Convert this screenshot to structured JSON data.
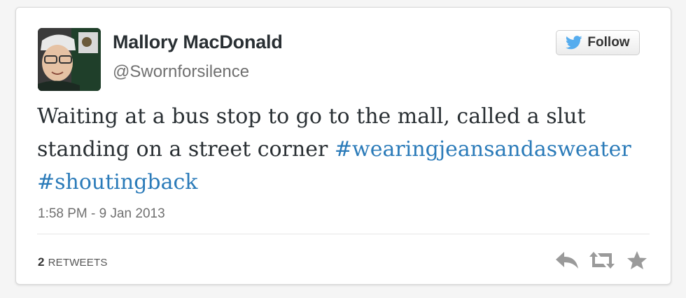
{
  "author": {
    "name": "Mallory MacDonald",
    "handle": "@Swornforsilence"
  },
  "follow_button": {
    "label": "Follow",
    "icon": "twitter-bird-icon",
    "accent": "#55acee"
  },
  "tweet": {
    "text_part1": "Waiting at a bus stop to go to the mall, called a slut standing on a street corner ",
    "hashtags": [
      "#wearingjeansandasweater",
      "#shoutingback"
    ],
    "link_color": "#2b7bb9"
  },
  "timestamp": "1:58 PM - 9 Jan 2013",
  "stats": {
    "retweet_count": "2",
    "retweet_label": "Retweets"
  },
  "actions": {
    "icons": [
      "reply-icon",
      "retweet-icon",
      "favorite-icon"
    ],
    "color": "#9a9a9a"
  }
}
